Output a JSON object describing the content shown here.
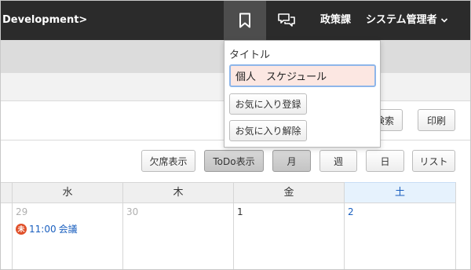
{
  "topbar": {
    "breadcrumb": "Development>",
    "department": "政策課",
    "user": "システム管理者",
    "user_caret": "⌄",
    "colors": {
      "background": "#2b2b2b",
      "active_tab": "#4d4d4d"
    }
  },
  "panel": {
    "search_label": "検索",
    "print_label": "印刷"
  },
  "toolbar": {
    "absent_label": "欠席表示",
    "todo_label": "ToDo表示",
    "month_label": "月",
    "week_label": "週",
    "day_label": "日",
    "list_label": "リスト"
  },
  "calendar": {
    "headers": [
      "",
      "水",
      "木",
      "金",
      "土"
    ],
    "cells": [
      {
        "day": ""
      },
      {
        "day": "29",
        "event": {
          "badge": "未",
          "time": "11:00",
          "title": "会議"
        }
      },
      {
        "day": "30"
      },
      {
        "day": "1"
      },
      {
        "day": "2"
      }
    ]
  },
  "popup": {
    "title_label": "タイトル",
    "title_value": "個人　スケジュール",
    "add_favorite_label": "お気に入り登録",
    "remove_favorite_label": "お気に入り解除"
  }
}
